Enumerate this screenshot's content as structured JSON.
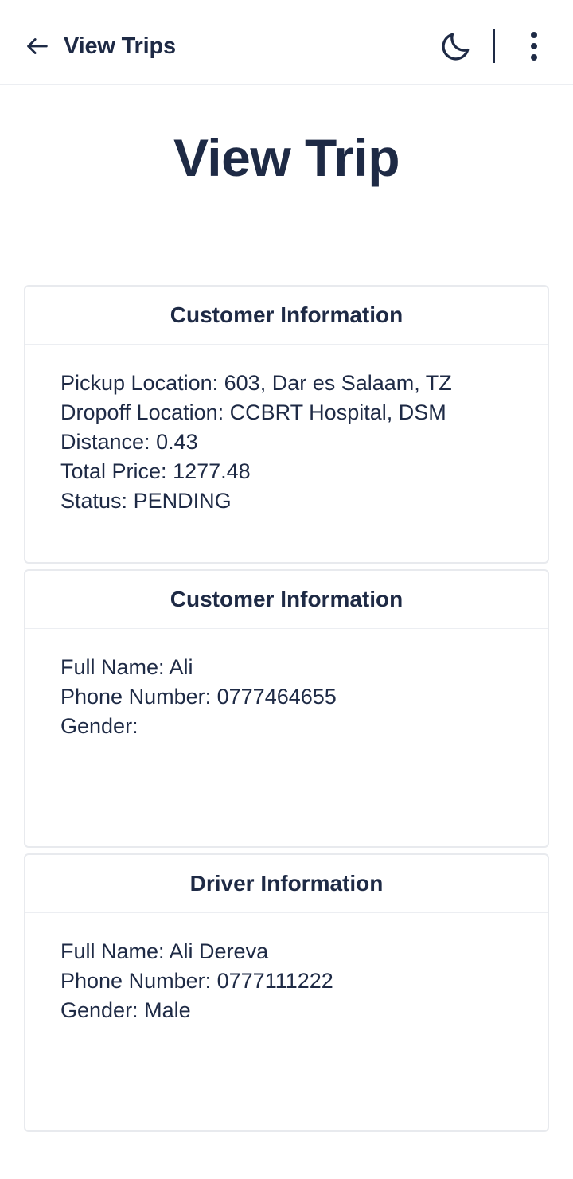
{
  "header": {
    "back_label": "View Trips"
  },
  "page": {
    "title": "View Trip"
  },
  "trip_card": {
    "title": "Customer Information",
    "pickup_label": "Pickup Location:",
    "pickup_value": "603, Dar es Salaam, TZ",
    "dropoff_label": "Dropoff Location:",
    "dropoff_value": "CCBRT Hospital, DSM",
    "distance_label": "Distance:",
    "distance_value": "0.43",
    "price_label": "Total Price:",
    "price_value": "1277.48",
    "status_label": "Status:",
    "status_value": "PENDING"
  },
  "customer_card": {
    "title": "Customer Information",
    "name_label": "Full Name:",
    "name_value": "Ali",
    "phone_label": "Phone Number:",
    "phone_value": "0777464655",
    "gender_label": "Gender:",
    "gender_value": ""
  },
  "driver_card": {
    "title": "Driver Information",
    "name_label": "Full Name:",
    "name_value": "Ali Dereva",
    "phone_label": "Phone Number:",
    "phone_value": "0777111222",
    "gender_label": "Gender:",
    "gender_value": "Male"
  },
  "icons": {
    "back": "arrow-left-icon",
    "theme": "moon-icon",
    "menu": "more-vertical-icon"
  },
  "colors": {
    "text": "#1e2a45",
    "border": "#e8eaee",
    "background": "#ffffff"
  }
}
